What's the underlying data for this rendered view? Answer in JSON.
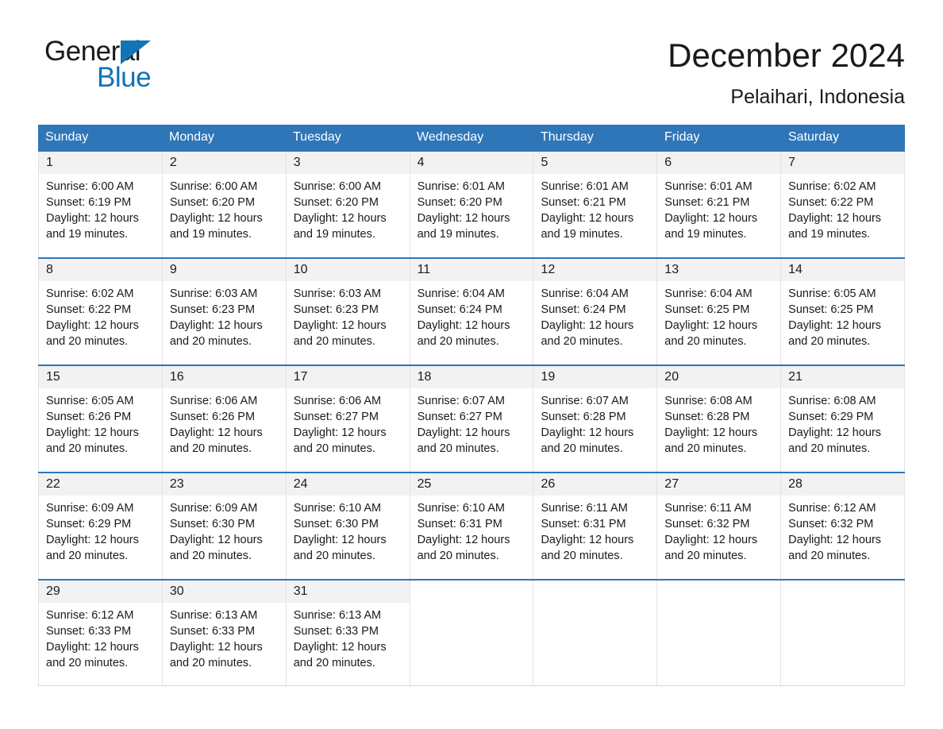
{
  "brand": {
    "name_part1": "General",
    "name_part2": "Blue",
    "accent_color": "#1273b5"
  },
  "header": {
    "month_title": "December 2024",
    "location": "Pelaihari, Indonesia"
  },
  "calendar": {
    "header_bg": "#2f76b8",
    "weekdays": [
      "Sunday",
      "Monday",
      "Tuesday",
      "Wednesday",
      "Thursday",
      "Friday",
      "Saturday"
    ],
    "weeks": [
      [
        {
          "day": "1",
          "sunrise": "Sunrise: 6:00 AM",
          "sunset": "Sunset: 6:19 PM",
          "daylight": "Daylight: 12 hours and 19 minutes."
        },
        {
          "day": "2",
          "sunrise": "Sunrise: 6:00 AM",
          "sunset": "Sunset: 6:20 PM",
          "daylight": "Daylight: 12 hours and 19 minutes."
        },
        {
          "day": "3",
          "sunrise": "Sunrise: 6:00 AM",
          "sunset": "Sunset: 6:20 PM",
          "daylight": "Daylight: 12 hours and 19 minutes."
        },
        {
          "day": "4",
          "sunrise": "Sunrise: 6:01 AM",
          "sunset": "Sunset: 6:20 PM",
          "daylight": "Daylight: 12 hours and 19 minutes."
        },
        {
          "day": "5",
          "sunrise": "Sunrise: 6:01 AM",
          "sunset": "Sunset: 6:21 PM",
          "daylight": "Daylight: 12 hours and 19 minutes."
        },
        {
          "day": "6",
          "sunrise": "Sunrise: 6:01 AM",
          "sunset": "Sunset: 6:21 PM",
          "daylight": "Daylight: 12 hours and 19 minutes."
        },
        {
          "day": "7",
          "sunrise": "Sunrise: 6:02 AM",
          "sunset": "Sunset: 6:22 PM",
          "daylight": "Daylight: 12 hours and 19 minutes."
        }
      ],
      [
        {
          "day": "8",
          "sunrise": "Sunrise: 6:02 AM",
          "sunset": "Sunset: 6:22 PM",
          "daylight": "Daylight: 12 hours and 20 minutes."
        },
        {
          "day": "9",
          "sunrise": "Sunrise: 6:03 AM",
          "sunset": "Sunset: 6:23 PM",
          "daylight": "Daylight: 12 hours and 20 minutes."
        },
        {
          "day": "10",
          "sunrise": "Sunrise: 6:03 AM",
          "sunset": "Sunset: 6:23 PM",
          "daylight": "Daylight: 12 hours and 20 minutes."
        },
        {
          "day": "11",
          "sunrise": "Sunrise: 6:04 AM",
          "sunset": "Sunset: 6:24 PM",
          "daylight": "Daylight: 12 hours and 20 minutes."
        },
        {
          "day": "12",
          "sunrise": "Sunrise: 6:04 AM",
          "sunset": "Sunset: 6:24 PM",
          "daylight": "Daylight: 12 hours and 20 minutes."
        },
        {
          "day": "13",
          "sunrise": "Sunrise: 6:04 AM",
          "sunset": "Sunset: 6:25 PM",
          "daylight": "Daylight: 12 hours and 20 minutes."
        },
        {
          "day": "14",
          "sunrise": "Sunrise: 6:05 AM",
          "sunset": "Sunset: 6:25 PM",
          "daylight": "Daylight: 12 hours and 20 minutes."
        }
      ],
      [
        {
          "day": "15",
          "sunrise": "Sunrise: 6:05 AM",
          "sunset": "Sunset: 6:26 PM",
          "daylight": "Daylight: 12 hours and 20 minutes."
        },
        {
          "day": "16",
          "sunrise": "Sunrise: 6:06 AM",
          "sunset": "Sunset: 6:26 PM",
          "daylight": "Daylight: 12 hours and 20 minutes."
        },
        {
          "day": "17",
          "sunrise": "Sunrise: 6:06 AM",
          "sunset": "Sunset: 6:27 PM",
          "daylight": "Daylight: 12 hours and 20 minutes."
        },
        {
          "day": "18",
          "sunrise": "Sunrise: 6:07 AM",
          "sunset": "Sunset: 6:27 PM",
          "daylight": "Daylight: 12 hours and 20 minutes."
        },
        {
          "day": "19",
          "sunrise": "Sunrise: 6:07 AM",
          "sunset": "Sunset: 6:28 PM",
          "daylight": "Daylight: 12 hours and 20 minutes."
        },
        {
          "day": "20",
          "sunrise": "Sunrise: 6:08 AM",
          "sunset": "Sunset: 6:28 PM",
          "daylight": "Daylight: 12 hours and 20 minutes."
        },
        {
          "day": "21",
          "sunrise": "Sunrise: 6:08 AM",
          "sunset": "Sunset: 6:29 PM",
          "daylight": "Daylight: 12 hours and 20 minutes."
        }
      ],
      [
        {
          "day": "22",
          "sunrise": "Sunrise: 6:09 AM",
          "sunset": "Sunset: 6:29 PM",
          "daylight": "Daylight: 12 hours and 20 minutes."
        },
        {
          "day": "23",
          "sunrise": "Sunrise: 6:09 AM",
          "sunset": "Sunset: 6:30 PM",
          "daylight": "Daylight: 12 hours and 20 minutes."
        },
        {
          "day": "24",
          "sunrise": "Sunrise: 6:10 AM",
          "sunset": "Sunset: 6:30 PM",
          "daylight": "Daylight: 12 hours and 20 minutes."
        },
        {
          "day": "25",
          "sunrise": "Sunrise: 6:10 AM",
          "sunset": "Sunset: 6:31 PM",
          "daylight": "Daylight: 12 hours and 20 minutes."
        },
        {
          "day": "26",
          "sunrise": "Sunrise: 6:11 AM",
          "sunset": "Sunset: 6:31 PM",
          "daylight": "Daylight: 12 hours and 20 minutes."
        },
        {
          "day": "27",
          "sunrise": "Sunrise: 6:11 AM",
          "sunset": "Sunset: 6:32 PM",
          "daylight": "Daylight: 12 hours and 20 minutes."
        },
        {
          "day": "28",
          "sunrise": "Sunrise: 6:12 AM",
          "sunset": "Sunset: 6:32 PM",
          "daylight": "Daylight: 12 hours and 20 minutes."
        }
      ],
      [
        {
          "day": "29",
          "sunrise": "Sunrise: 6:12 AM",
          "sunset": "Sunset: 6:33 PM",
          "daylight": "Daylight: 12 hours and 20 minutes."
        },
        {
          "day": "30",
          "sunrise": "Sunrise: 6:13 AM",
          "sunset": "Sunset: 6:33 PM",
          "daylight": "Daylight: 12 hours and 20 minutes."
        },
        {
          "day": "31",
          "sunrise": "Sunrise: 6:13 AM",
          "sunset": "Sunset: 6:33 PM",
          "daylight": "Daylight: 12 hours and 20 minutes."
        },
        {
          "day": "",
          "sunrise": "",
          "sunset": "",
          "daylight": ""
        },
        {
          "day": "",
          "sunrise": "",
          "sunset": "",
          "daylight": ""
        },
        {
          "day": "",
          "sunrise": "",
          "sunset": "",
          "daylight": ""
        },
        {
          "day": "",
          "sunrise": "",
          "sunset": "",
          "daylight": ""
        }
      ]
    ]
  }
}
